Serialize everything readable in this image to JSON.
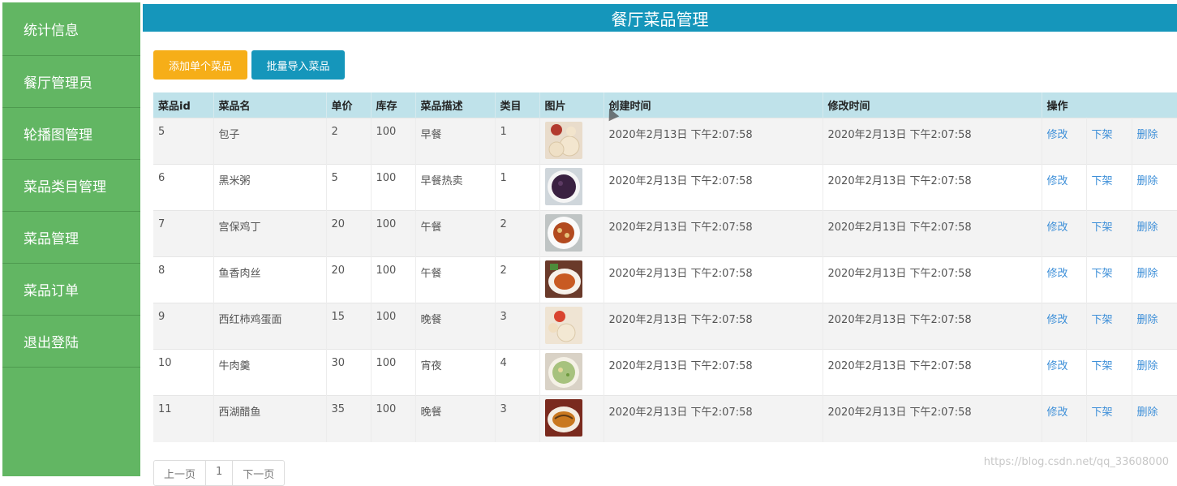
{
  "sidebar": {
    "items": [
      {
        "label": "统计信息"
      },
      {
        "label": "餐厅管理员"
      },
      {
        "label": "轮播图管理"
      },
      {
        "label": "菜品类目管理"
      },
      {
        "label": "菜品管理"
      },
      {
        "label": "菜品订单"
      },
      {
        "label": "退出登陆"
      }
    ]
  },
  "header": {
    "title": "餐厅菜品管理"
  },
  "toolbar": {
    "add_label": "添加单个菜品",
    "import_label": "批量导入菜品"
  },
  "table": {
    "headers": [
      "菜品id",
      "菜品名",
      "单价",
      "库存",
      "菜品描述",
      "类目",
      "图片",
      "创建时间",
      "修改时间",
      "操作"
    ],
    "rows": [
      {
        "id": "5",
        "name": "包子",
        "price": "2",
        "stock": "100",
        "desc": "早餐",
        "category": "1",
        "created": "2020年2月13日 下午2:07:58",
        "modified": "2020年2月13日 下午2:07:58"
      },
      {
        "id": "6",
        "name": "黑米粥",
        "price": "5",
        "stock": "100",
        "desc": "早餐热卖",
        "category": "1",
        "created": "2020年2月13日 下午2:07:58",
        "modified": "2020年2月13日 下午2:07:58"
      },
      {
        "id": "7",
        "name": "宫保鸡丁",
        "price": "20",
        "stock": "100",
        "desc": "午餐",
        "category": "2",
        "created": "2020年2月13日 下午2:07:58",
        "modified": "2020年2月13日 下午2:07:58"
      },
      {
        "id": "8",
        "name": "鱼香肉丝",
        "price": "20",
        "stock": "100",
        "desc": "午餐",
        "category": "2",
        "created": "2020年2月13日 下午2:07:58",
        "modified": "2020年2月13日 下午2:07:58"
      },
      {
        "id": "9",
        "name": "西红柿鸡蛋面",
        "price": "15",
        "stock": "100",
        "desc": "晚餐",
        "category": "3",
        "created": "2020年2月13日 下午2:07:58",
        "modified": "2020年2月13日 下午2:07:58"
      },
      {
        "id": "10",
        "name": "牛肉羹",
        "price": "30",
        "stock": "100",
        "desc": "宵夜",
        "category": "4",
        "created": "2020年2月13日 下午2:07:58",
        "modified": "2020年2月13日 下午2:07:58"
      },
      {
        "id": "11",
        "name": "西湖醋鱼",
        "price": "35",
        "stock": "100",
        "desc": "晚餐",
        "category": "3",
        "created": "2020年2月13日 下午2:07:58",
        "modified": "2020年2月13日 下午2:07:58"
      }
    ],
    "actions": {
      "edit": "修改",
      "offline": "下架",
      "delete": "删除"
    }
  },
  "pagination": {
    "prev": "上一页",
    "page": "1",
    "next": "下一页"
  },
  "watermark": "https://blog.csdn.net/qq_33608000",
  "colors": {
    "sidebar": "#62b663",
    "header": "#1596bb",
    "add_button": "#f6ae18",
    "import_button": "#1596bb",
    "link": "#3d8fd8"
  }
}
